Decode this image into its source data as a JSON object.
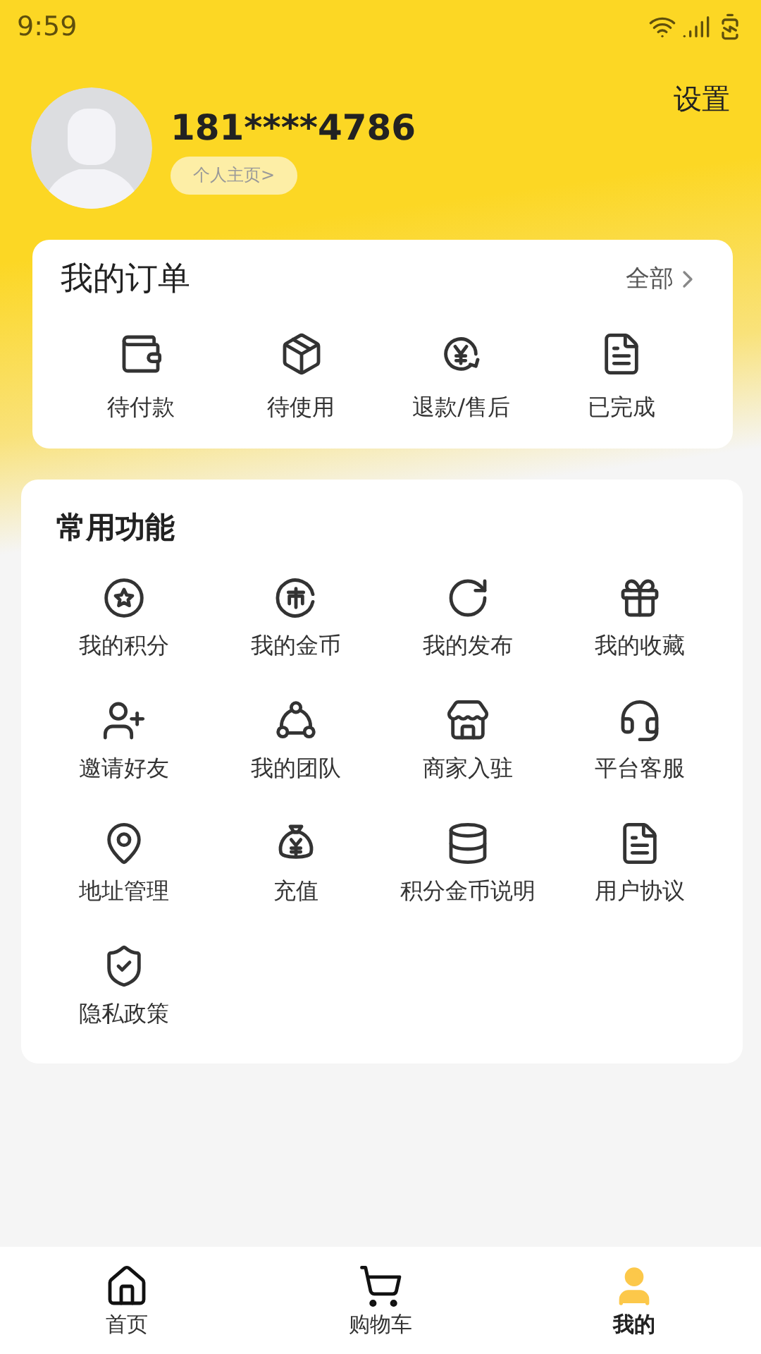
{
  "status_bar": {
    "time": "9:59"
  },
  "profile": {
    "phone": "181****4786",
    "homepage_link": "个人主页>",
    "settings": "设置"
  },
  "orders": {
    "title": "我的订单",
    "all_link": "全部",
    "items": [
      {
        "label": "待付款"
      },
      {
        "label": "待使用"
      },
      {
        "label": "退款/售后"
      },
      {
        "label": "已完成"
      }
    ]
  },
  "functions": {
    "title": "常用功能",
    "items": [
      {
        "label": "我的积分"
      },
      {
        "label": "我的金币"
      },
      {
        "label": "我的发布"
      },
      {
        "label": "我的收藏"
      },
      {
        "label": "邀请好友"
      },
      {
        "label": "我的团队"
      },
      {
        "label": "商家入驻"
      },
      {
        "label": "平台客服"
      },
      {
        "label": "地址管理"
      },
      {
        "label": "充值"
      },
      {
        "label": "积分金币说明"
      },
      {
        "label": "用户协议"
      },
      {
        "label": "隐私政策"
      }
    ]
  },
  "tab_bar": [
    {
      "label": "首页",
      "selected": false
    },
    {
      "label": "购物车",
      "selected": false
    },
    {
      "label": "我的",
      "selected": true
    }
  ]
}
